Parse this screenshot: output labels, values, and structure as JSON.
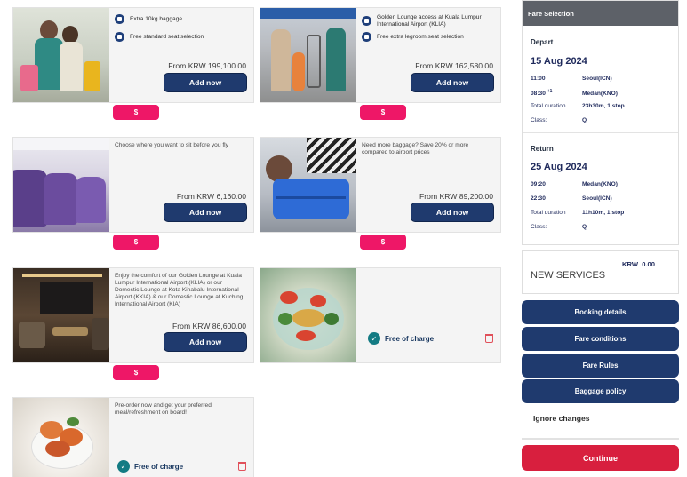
{
  "cards": {
    "baggage_seat": {
      "features": [
        "Extra 10kg baggage",
        "Free standard seat selection"
      ],
      "price": "From KRW 199,100.00",
      "button": "Add now",
      "tag": "$"
    },
    "lounge_legroom": {
      "features": [
        "Golden Lounge access at Kuala Lumpur International Airport (KLIA)",
        "Free extra legroom seat selection"
      ],
      "price": "From KRW 162,580.00",
      "button": "Add now",
      "tag": "$"
    },
    "seat_selection": {
      "description": "Choose where you want to sit before you fly",
      "price": "From KRW 6,160.00",
      "button": "Add now",
      "tag": "$"
    },
    "extra_baggage": {
      "description": "Need more baggage? Save 20% or more compared to airport prices",
      "price": "From KRW 89,200.00",
      "button": "Add now",
      "tag": "$"
    },
    "golden_lounge": {
      "description": "Enjoy the comfort of our Golden Lounge at Kuala Lumpur International Airport (KLIA) or our Domestic Lounge at Kota Kinabalu International Airport (KKIA) & our Domestic Lounge at Kuching International Airport (KIA)",
      "price": "From KRW 86,600.00",
      "button": "Add now",
      "tag": "$"
    },
    "salad": {
      "free_label": "Free of charge"
    },
    "meal_preorder": {
      "description": "Pre-order now and get your preferred meal/refreshment on board!",
      "free_label": "Free of charge"
    }
  },
  "sidebar": {
    "header": "Fare Selection",
    "depart": {
      "label": "Depart",
      "date": "15 Aug 2024",
      "dep_time": "11:00",
      "dep_airport": "Seoul(ICN)",
      "arr_time": "08:30",
      "arr_offset": "+1",
      "arr_airport": "Medan(KNO)",
      "duration_label": "Total duration",
      "duration": "23h30m, 1 stop",
      "class_label": "Class:",
      "class": "Q"
    },
    "return": {
      "label": "Return",
      "date": "25 Aug 2024",
      "dep_time": "09:20",
      "dep_airport": "Medan(KNO)",
      "arr_time": "22:30",
      "arr_airport": "Seoul(ICN)",
      "duration_label": "Total duration",
      "duration": "11h10m, 1 stop",
      "class_label": "Class:",
      "class": "Q"
    },
    "new_services": {
      "amount": "KRW  0.00",
      "label": "NEW SERVICES"
    },
    "buttons": [
      "Booking details",
      "Fare conditions",
      "Fare Rules",
      "Baggage policy"
    ],
    "ignore": "Ignore changes",
    "continue": "Continue"
  },
  "colors": {
    "navy": "#1f3a6e",
    "pink": "#ee1767",
    "red": "#d81f3e",
    "teal": "#137b83"
  }
}
